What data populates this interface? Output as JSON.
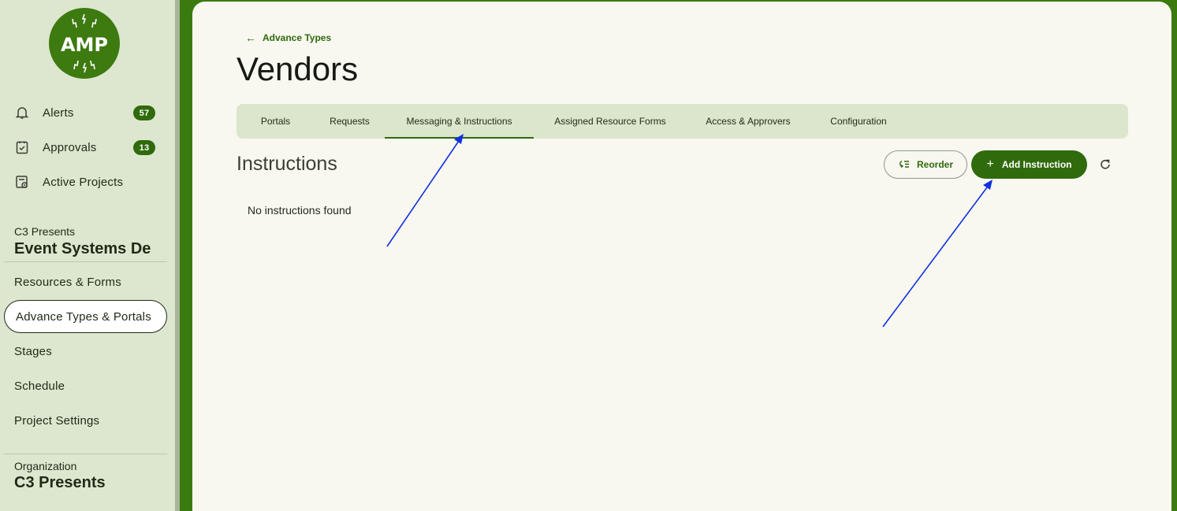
{
  "sidebar": {
    "logo_text": "AMP",
    "nav": [
      {
        "label": "Alerts",
        "badge": "57"
      },
      {
        "label": "Approvals",
        "badge": "13"
      },
      {
        "label": "Active Projects"
      }
    ],
    "project": {
      "subtitle": "C3 Presents",
      "title": "Event Systems De",
      "links": [
        "Resources & Forms",
        "Advance Types & Portals",
        "Stages",
        "Schedule",
        "Project Settings"
      ]
    },
    "organization": {
      "subtitle": "Organization",
      "title": "C3 Presents"
    }
  },
  "main": {
    "back_label": "Advance Types",
    "title": "Vendors",
    "tabs": [
      "Portals",
      "Requests",
      "Messaging & Instructions",
      "Assigned Resource Forms",
      "Access & Approvers",
      "Configuration"
    ],
    "active_tab": "Messaging & Instructions",
    "section_heading": "Instructions",
    "reorder_label": "Reorder",
    "add_label": "Add Instruction",
    "empty_text": "No instructions found"
  },
  "colors": {
    "brand_green": "#2f6a0c",
    "sidebar_bg": "#dde7cf",
    "tabs_bg": "#dce6cc",
    "main_bg": "#f8f7f0",
    "annotation_arrow": "#1030e0"
  }
}
